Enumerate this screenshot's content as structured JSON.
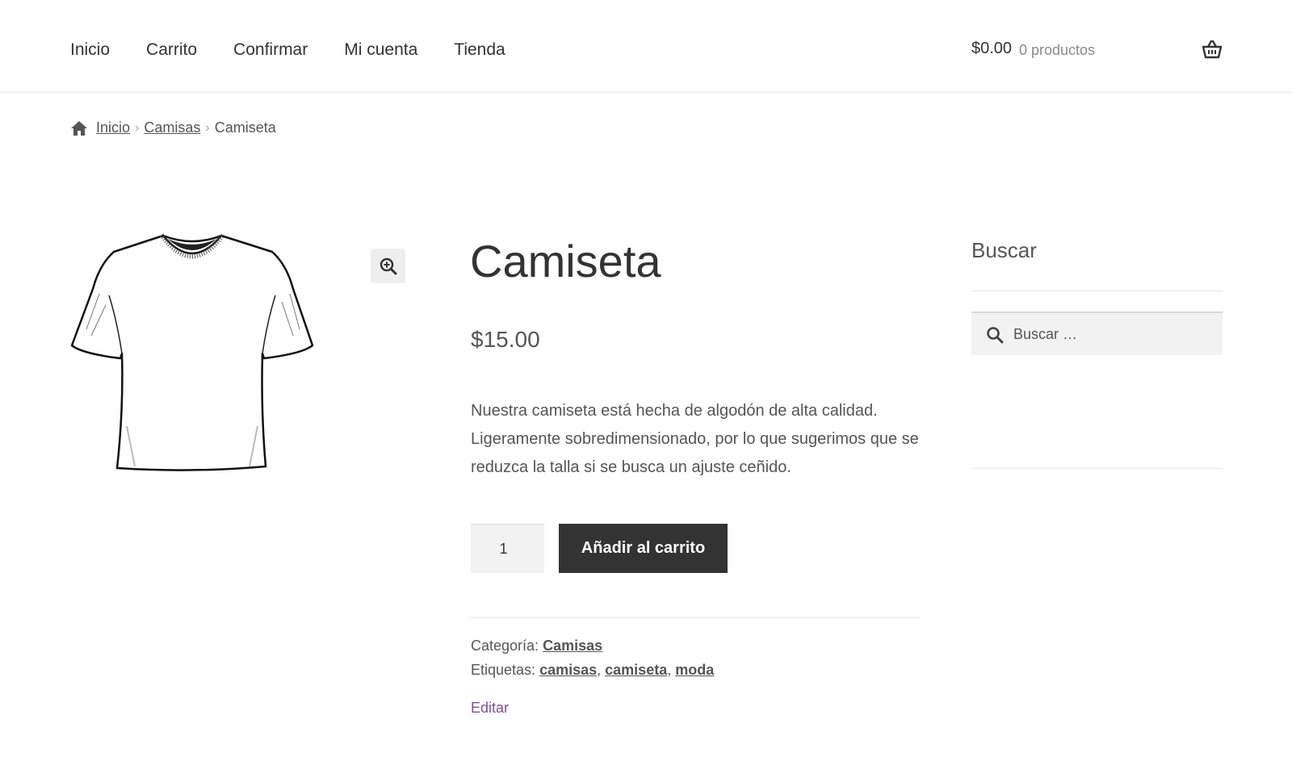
{
  "nav": {
    "items": [
      "Inicio",
      "Carrito",
      "Confirmar",
      "Mi cuenta",
      "Tienda"
    ]
  },
  "cart": {
    "total": "$0.00",
    "count": "0 productos"
  },
  "breadcrumb": {
    "home": "Inicio",
    "category": "Camisas",
    "current": "Camiseta"
  },
  "product": {
    "title": "Camiseta",
    "price": "$15.00",
    "description": "Nuestra camiseta está hecha de algodón de alta calidad. Ligeramente sobredimensionado, por lo que sugerimos que se reduzca la talla si se busca un ajuste ceñido.",
    "quantity": "1",
    "add_to_cart": "Añadir al carrito",
    "category_label": "Categoría:",
    "category": "Camisas",
    "tags_label": "Etiquetas:",
    "tags": [
      "camisas",
      "camiseta",
      "moda"
    ],
    "edit": "Editar"
  },
  "sidebar": {
    "search_title": "Buscar",
    "search_placeholder": "Buscar …"
  }
}
